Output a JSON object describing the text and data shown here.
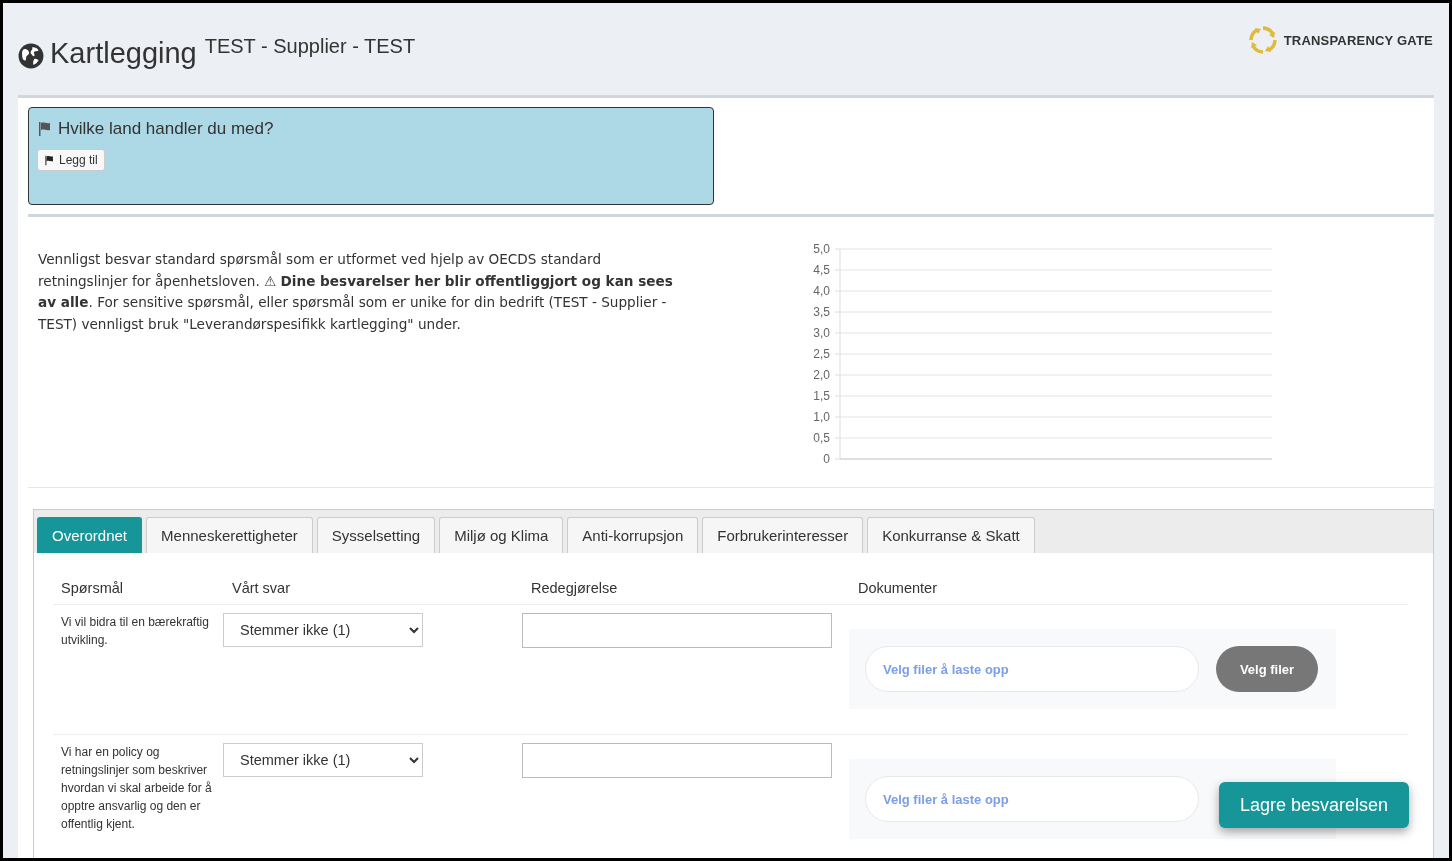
{
  "header": {
    "title": "Kartlegging",
    "subtitle": "TEST - Supplier - TEST",
    "logo_text": "TRANSPARENCY GATE"
  },
  "countries": {
    "heading": "Hvilke land handler du med?",
    "add_button": "Legg til"
  },
  "intro": {
    "text": "Vennligst besvar standard spørsmål som er utformet ved hjelp av OECDS standard retningslinjer for åpenhetsloven. ⚠ **Dine besvarelser her blir offentliggjort og kan sees av alle**. For sensitive spørsmål, eller spørsmål som er unike for din bedrift (TEST - Supplier - TEST) vennligst bruk \"Leverandørspesifikk kartlegging\" under."
  },
  "score_chart": {
    "axis_labels": [
      "5,0",
      "4,5",
      "4,0",
      "3,5",
      "3,0",
      "2,5",
      "2,0",
      "1,5",
      "1,0",
      "0,5",
      "0"
    ]
  },
  "tabs": [
    {
      "label": "Overordnet",
      "selected": true
    },
    {
      "label": "Menneskerettigheter",
      "selected": false
    },
    {
      "label": "Sysselsetting",
      "selected": false
    },
    {
      "label": "Miljø og Klima",
      "selected": false
    },
    {
      "label": "Anti-korrupsjon",
      "selected": false
    },
    {
      "label": "Forbrukerinteresser",
      "selected": false
    },
    {
      "label": "Konkurranse & Skatt",
      "selected": false
    }
  ],
  "table": {
    "columns": [
      "Spørsmål",
      "Vårt svar",
      "Redegjørelse",
      "Dokumenter"
    ],
    "rows": [
      {
        "question": "Vi vil bidra til en bærekraftig utvikling.",
        "answer": "Stemmer ikke (1)",
        "upload_placeholder": "Velg filer å laste opp",
        "upload_button": "Velg filer"
      },
      {
        "question": "Vi har en policy og retningslinjer som beskriver hvordan vi skal arbeide for å opptre ansvarlig og den er offentlig kjent.",
        "answer": "Stemmer ikke (1)",
        "upload_placeholder": "Velg filer å laste opp"
      }
    ]
  },
  "save_button": "Lagre besvarelsen"
}
